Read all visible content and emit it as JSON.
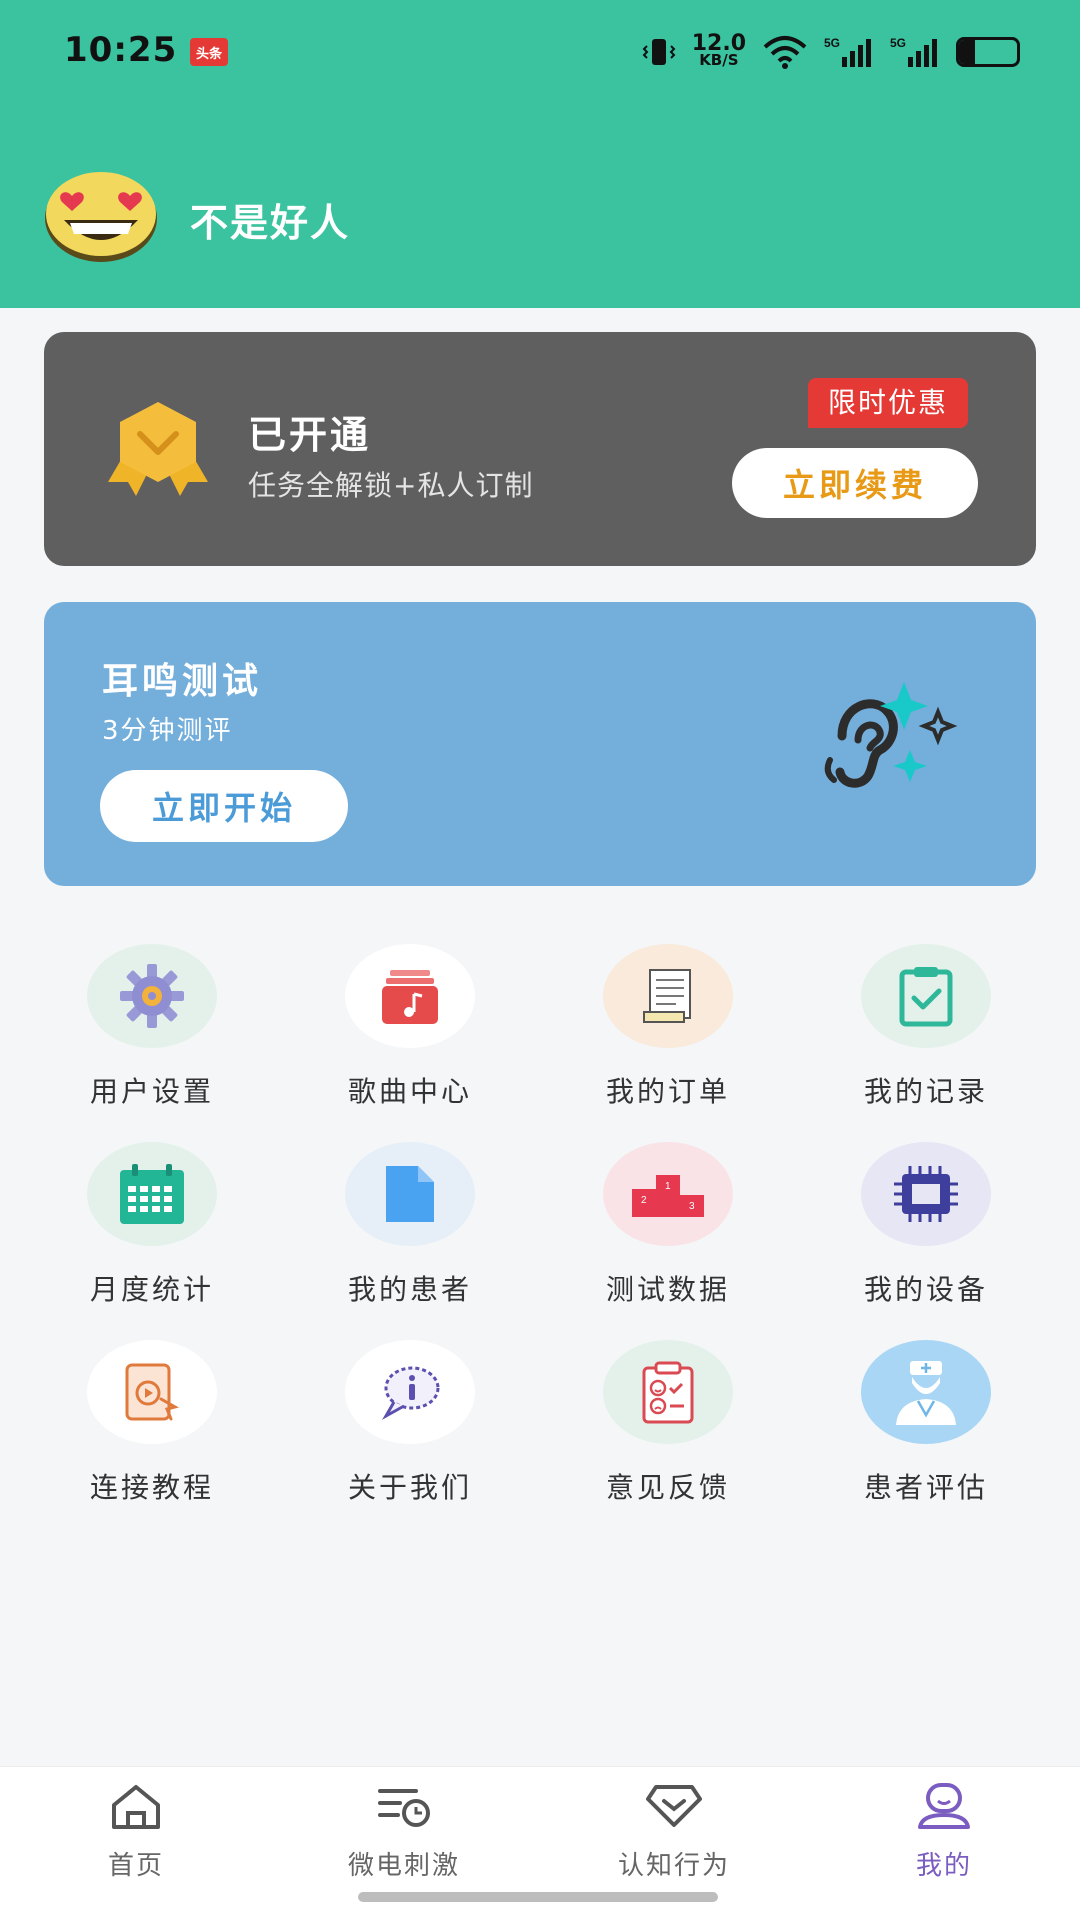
{
  "status_bar": {
    "time": "10:25",
    "news_badge": "头条",
    "net_speed_value": "12.0",
    "net_speed_unit": "KB/S",
    "signal_1": "5G",
    "signal_2": "5G",
    "battery": "27",
    "battery_level": 0.27
  },
  "profile": {
    "username": "不是好人"
  },
  "vip": {
    "title": "已开通",
    "subtitle": "任务全解锁+私人订制",
    "promo_tag": "限时优惠",
    "renew_button": "立即续费"
  },
  "test_card": {
    "title": "耳鸣测试",
    "subtitle": "3分钟测评",
    "start_button": "立即开始"
  },
  "grid": [
    {
      "label": "用户设置",
      "icon": "gear-icon"
    },
    {
      "label": "歌曲中心",
      "icon": "music-icon"
    },
    {
      "label": "我的订单",
      "icon": "order-icon"
    },
    {
      "label": "我的记录",
      "icon": "clipboard-icon"
    },
    {
      "label": "月度统计",
      "icon": "calendar-icon"
    },
    {
      "label": "我的患者",
      "icon": "file-icon"
    },
    {
      "label": "测试数据",
      "icon": "podium-icon"
    },
    {
      "label": "我的设备",
      "icon": "chip-icon"
    },
    {
      "label": "连接教程",
      "icon": "tutorial-icon"
    },
    {
      "label": "关于我们",
      "icon": "info-icon"
    },
    {
      "label": "意见反馈",
      "icon": "feedback-icon"
    },
    {
      "label": "患者评估",
      "icon": "doctor-icon"
    }
  ],
  "bottom_nav": [
    {
      "label": "首页",
      "icon": "home-icon"
    },
    {
      "label": "微电刺激",
      "icon": "stimulation-icon"
    },
    {
      "label": "认知行为",
      "icon": "cognition-icon"
    },
    {
      "label": "我的",
      "icon": "profile-icon",
      "active": true
    }
  ],
  "colors": {
    "header": "#3bc29f",
    "vip_card": "#5f5f5f",
    "test_card": "#74aedb",
    "accent_orange": "#e89a17",
    "promo_red": "#e53935",
    "active_nav": "#7b5cc0"
  }
}
